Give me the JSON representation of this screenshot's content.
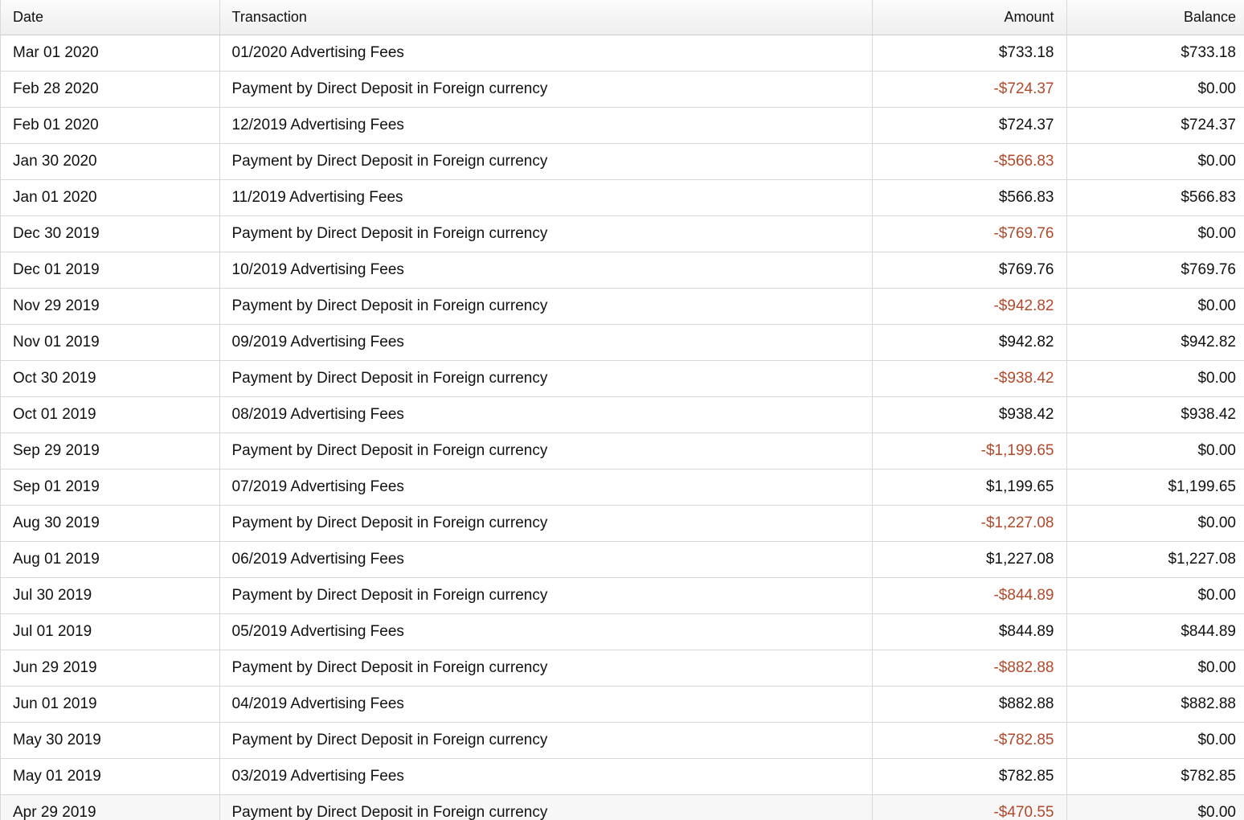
{
  "table": {
    "headers": {
      "date": "Date",
      "transaction": "Transaction",
      "amount": "Amount",
      "balance": "Balance"
    },
    "negative_color": "#b1492b",
    "rows": [
      {
        "date": "Mar 01 2020",
        "transaction": "01/2020 Advertising Fees",
        "amount": "$733.18",
        "balance": "$733.18",
        "negative": false
      },
      {
        "date": "Feb 28 2020",
        "transaction": "Payment by Direct Deposit in Foreign currency",
        "amount": "-$724.37",
        "balance": "$0.00",
        "negative": true
      },
      {
        "date": "Feb 01 2020",
        "transaction": "12/2019 Advertising Fees",
        "amount": "$724.37",
        "balance": "$724.37",
        "negative": false
      },
      {
        "date": "Jan 30 2020",
        "transaction": "Payment by Direct Deposit in Foreign currency",
        "amount": "-$566.83",
        "balance": "$0.00",
        "negative": true
      },
      {
        "date": "Jan 01 2020",
        "transaction": "11/2019 Advertising Fees",
        "amount": "$566.83",
        "balance": "$566.83",
        "negative": false
      },
      {
        "date": "Dec 30 2019",
        "transaction": "Payment by Direct Deposit in Foreign currency",
        "amount": "-$769.76",
        "balance": "$0.00",
        "negative": true
      },
      {
        "date": "Dec 01 2019",
        "transaction": "10/2019 Advertising Fees",
        "amount": "$769.76",
        "balance": "$769.76",
        "negative": false
      },
      {
        "date": "Nov 29 2019",
        "transaction": "Payment by Direct Deposit in Foreign currency",
        "amount": "-$942.82",
        "balance": "$0.00",
        "negative": true
      },
      {
        "date": "Nov 01 2019",
        "transaction": "09/2019 Advertising Fees",
        "amount": "$942.82",
        "balance": "$942.82",
        "negative": false
      },
      {
        "date": "Oct 30 2019",
        "transaction": "Payment by Direct Deposit in Foreign currency",
        "amount": "-$938.42",
        "balance": "$0.00",
        "negative": true
      },
      {
        "date": "Oct 01 2019",
        "transaction": "08/2019 Advertising Fees",
        "amount": "$938.42",
        "balance": "$938.42",
        "negative": false
      },
      {
        "date": "Sep 29 2019",
        "transaction": "Payment by Direct Deposit in Foreign currency",
        "amount": "-$1,199.65",
        "balance": "$0.00",
        "negative": true
      },
      {
        "date": "Sep 01 2019",
        "transaction": "07/2019 Advertising Fees",
        "amount": "$1,199.65",
        "balance": "$1,199.65",
        "negative": false
      },
      {
        "date": "Aug 30 2019",
        "transaction": "Payment by Direct Deposit in Foreign currency",
        "amount": "-$1,227.08",
        "balance": "$0.00",
        "negative": true
      },
      {
        "date": "Aug 01 2019",
        "transaction": "06/2019 Advertising Fees",
        "amount": "$1,227.08",
        "balance": "$1,227.08",
        "negative": false
      },
      {
        "date": "Jul 30 2019",
        "transaction": "Payment by Direct Deposit in Foreign currency",
        "amount": "-$844.89",
        "balance": "$0.00",
        "negative": true
      },
      {
        "date": "Jul 01 2019",
        "transaction": "05/2019 Advertising Fees",
        "amount": "$844.89",
        "balance": "$844.89",
        "negative": false
      },
      {
        "date": "Jun 29 2019",
        "transaction": "Payment by Direct Deposit in Foreign currency",
        "amount": "-$882.88",
        "balance": "$0.00",
        "negative": true
      },
      {
        "date": "Jun 01 2019",
        "transaction": "04/2019 Advertising Fees",
        "amount": "$882.88",
        "balance": "$882.88",
        "negative": false
      },
      {
        "date": "May 30 2019",
        "transaction": "Payment by Direct Deposit in Foreign currency",
        "amount": "-$782.85",
        "balance": "$0.00",
        "negative": true
      },
      {
        "date": "May 01 2019",
        "transaction": "03/2019 Advertising Fees",
        "amount": "$782.85",
        "balance": "$782.85",
        "negative": false
      },
      {
        "date": "Apr 29 2019",
        "transaction": "Payment by Direct Deposit in Foreign currency",
        "amount": "-$470.55",
        "balance": "$0.00",
        "negative": true
      }
    ]
  }
}
